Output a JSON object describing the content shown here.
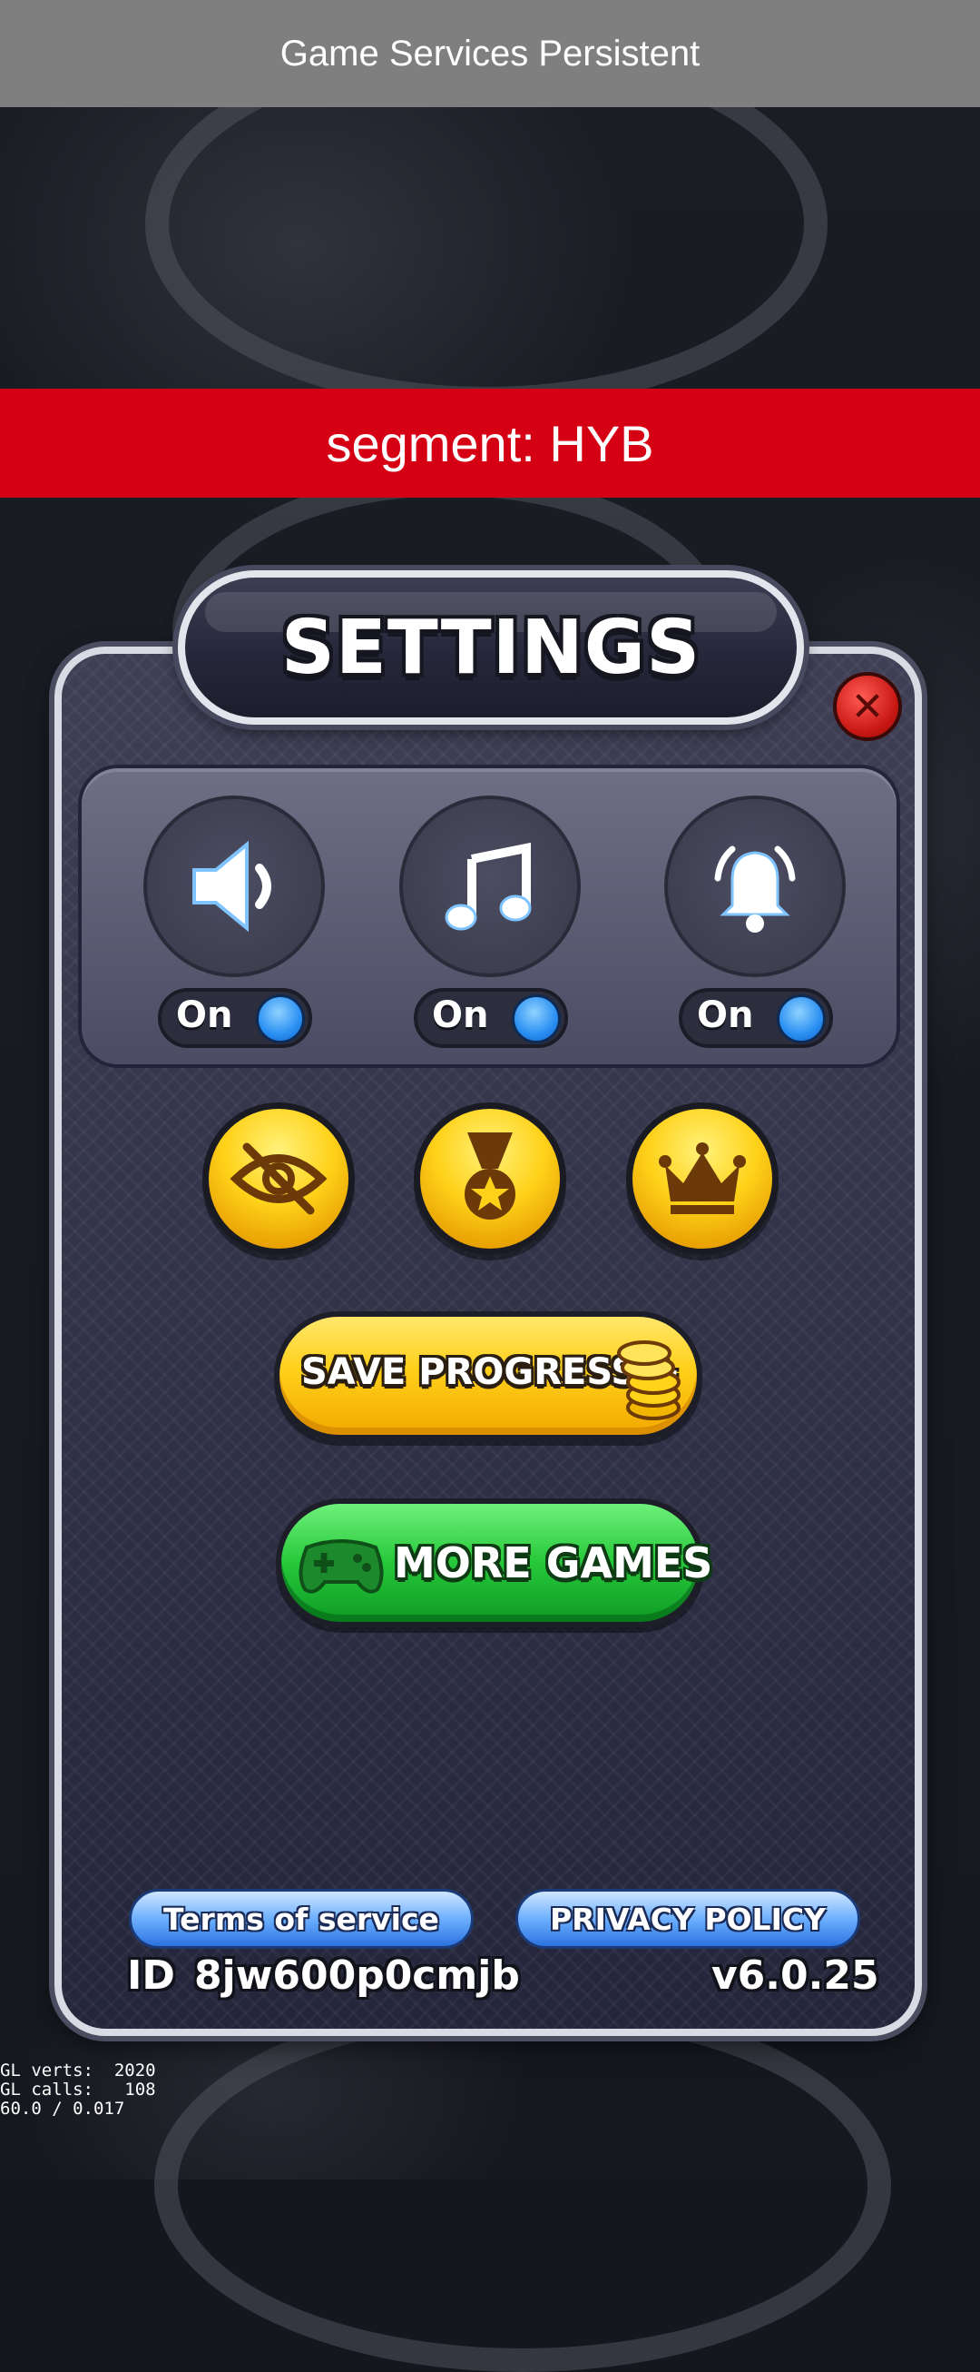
{
  "top_banner": {
    "text": "Game Services Persistent"
  },
  "segment_banner": {
    "text": "segment: HYB"
  },
  "settings": {
    "title": "SETTINGS",
    "close_icon": "close-icon",
    "toggles": [
      {
        "icon": "speaker-icon",
        "label": "On"
      },
      {
        "icon": "music-note-icon",
        "label": "On"
      },
      {
        "icon": "bell-icon",
        "label": "On"
      }
    ],
    "round_buttons": [
      "hidden-eye-icon",
      "medal-icon",
      "crown-icon"
    ],
    "save_progress": {
      "label": "SAVE PROGRESS +"
    },
    "more_games": {
      "label": "MORE GAMES"
    },
    "terms": {
      "label": "Terms of service"
    },
    "privacy": {
      "label": "PRIVACY POLICY"
    },
    "player_id": {
      "prefix": "ID",
      "value": "8jw600p0cmjb"
    },
    "version": "v6.0.25"
  },
  "debug": {
    "gl_verts": "GL verts:  2020",
    "gl_calls": "GL calls:   108",
    "fps": "60.0 / 0.017"
  },
  "colors": {
    "segment_red": "#d50014",
    "banner_gray": "#7f7f7f",
    "gold": "#ffd01a",
    "green": "#26c83a",
    "blue": "#2a8ff2"
  }
}
